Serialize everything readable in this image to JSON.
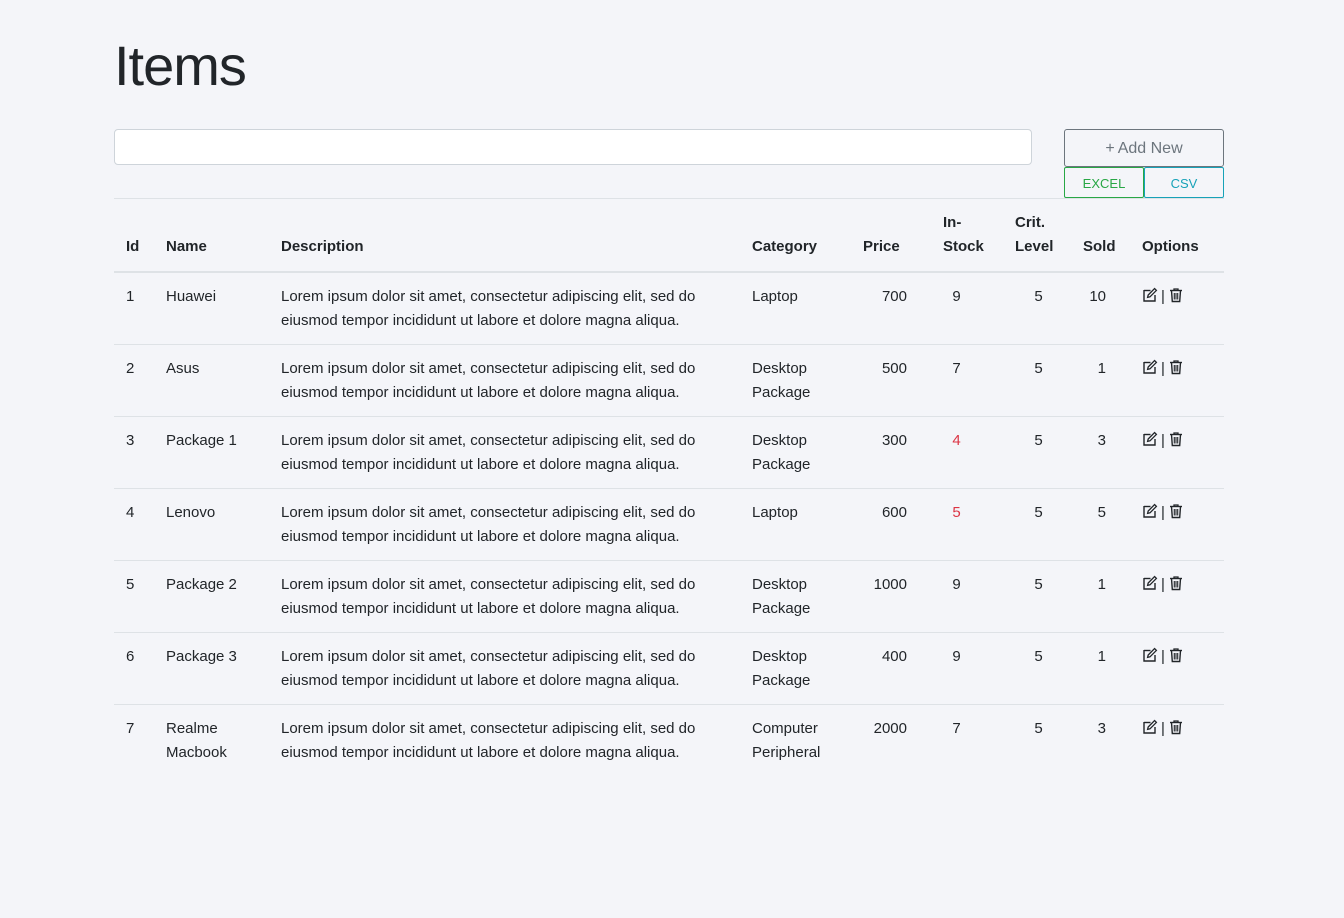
{
  "page": {
    "title": "Items"
  },
  "search": {
    "value": "",
    "placeholder": ""
  },
  "actions": {
    "add_new_label": "Add New",
    "add_new_icon": "plus-icon",
    "excel_label": "EXCEL",
    "csv_label": "CSV"
  },
  "colors": {
    "background": "#f4f5f9",
    "excel": "#28a745",
    "csv": "#17a2b8",
    "low_stock": "#dc3545",
    "add_button": "#6c757d"
  },
  "table": {
    "headers": {
      "id": "Id",
      "name": "Name",
      "description": "Description",
      "category": "Category",
      "price": "Price",
      "in_stock": "In-Stock",
      "crit_level": "Crit. Level",
      "sold": "Sold",
      "options": "Options"
    },
    "option_icons": [
      "edit-icon",
      "trash-icon"
    ],
    "option_separator": "|",
    "rows": [
      {
        "id": "1",
        "name": "Huawei",
        "description": "Lorem ipsum dolor sit amet, consectetur adipiscing elit, sed do eiusmod tempor incididunt ut labore et dolore magna aliqua.",
        "category": "Laptop",
        "price": "700",
        "in_stock": "9",
        "crit_level": "5",
        "sold": "10",
        "low_stock": false
      },
      {
        "id": "2",
        "name": "Asus",
        "description": "Lorem ipsum dolor sit amet, consectetur adipiscing elit, sed do eiusmod tempor incididunt ut labore et dolore magna aliqua.",
        "category": "Desktop Package",
        "price": "500",
        "in_stock": "7",
        "crit_level": "5",
        "sold": "1",
        "low_stock": false
      },
      {
        "id": "3",
        "name": "Package 1",
        "description": "Lorem ipsum dolor sit amet, consectetur adipiscing elit, sed do eiusmod tempor incididunt ut labore et dolore magna aliqua.",
        "category": "Desktop Package",
        "price": "300",
        "in_stock": "4",
        "crit_level": "5",
        "sold": "3",
        "low_stock": true
      },
      {
        "id": "4",
        "name": "Lenovo",
        "description": "Lorem ipsum dolor sit amet, consectetur adipiscing elit, sed do eiusmod tempor incididunt ut labore et dolore magna aliqua.",
        "category": "Laptop",
        "price": "600",
        "in_stock": "5",
        "crit_level": "5",
        "sold": "5",
        "low_stock": true
      },
      {
        "id": "5",
        "name": "Package 2",
        "description": "Lorem ipsum dolor sit amet, consectetur adipiscing elit, sed do eiusmod tempor incididunt ut labore et dolore magna aliqua.",
        "category": "Desktop Package",
        "price": "1000",
        "in_stock": "9",
        "crit_level": "5",
        "sold": "1",
        "low_stock": false
      },
      {
        "id": "6",
        "name": "Package 3",
        "description": "Lorem ipsum dolor sit amet, consectetur adipiscing elit, sed do eiusmod tempor incididunt ut labore et dolore magna aliqua.",
        "category": "Desktop Package",
        "price": "400",
        "in_stock": "9",
        "crit_level": "5",
        "sold": "1",
        "low_stock": false
      },
      {
        "id": "7",
        "name": "Realme Macbook",
        "description": "Lorem ipsum dolor sit amet, consectetur adipiscing elit, sed do eiusmod tempor incididunt ut labore et dolore magna aliqua.",
        "category": "Computer Peripheral",
        "price": "2000",
        "in_stock": "7",
        "crit_level": "5",
        "sold": "3",
        "low_stock": false
      }
    ]
  }
}
